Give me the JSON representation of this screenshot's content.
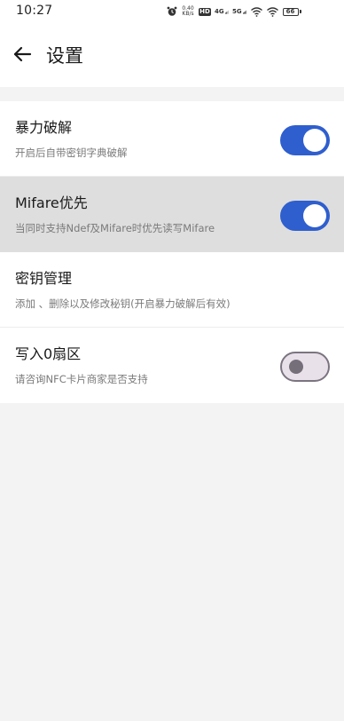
{
  "status_bar": {
    "time": "10:27",
    "net_speed_value": "0.40",
    "net_speed_unit": "KB/s",
    "hd_label": "HD",
    "signal_4g": "4G",
    "signal_5g": "5G",
    "battery": "66"
  },
  "header": {
    "title": "设置"
  },
  "settings": [
    {
      "title": "暴力破解",
      "description": "开启后自带密钥字典破解",
      "toggle": true
    },
    {
      "title": "Mifare优先",
      "description": "当同时支持Ndef及Mifare时优先读写Mifare",
      "toggle": true
    },
    {
      "title": "密钥管理",
      "description": "添加 、删除以及修改秘钥(开启暴力破解后有效)"
    },
    {
      "title": "写入0扇区",
      "description": "请咨询NFC卡片商家是否支持",
      "toggle": false
    }
  ],
  "colors": {
    "accent": "#2f5fce",
    "highlight_row": "#dedede",
    "background": "#f3f3f3"
  }
}
